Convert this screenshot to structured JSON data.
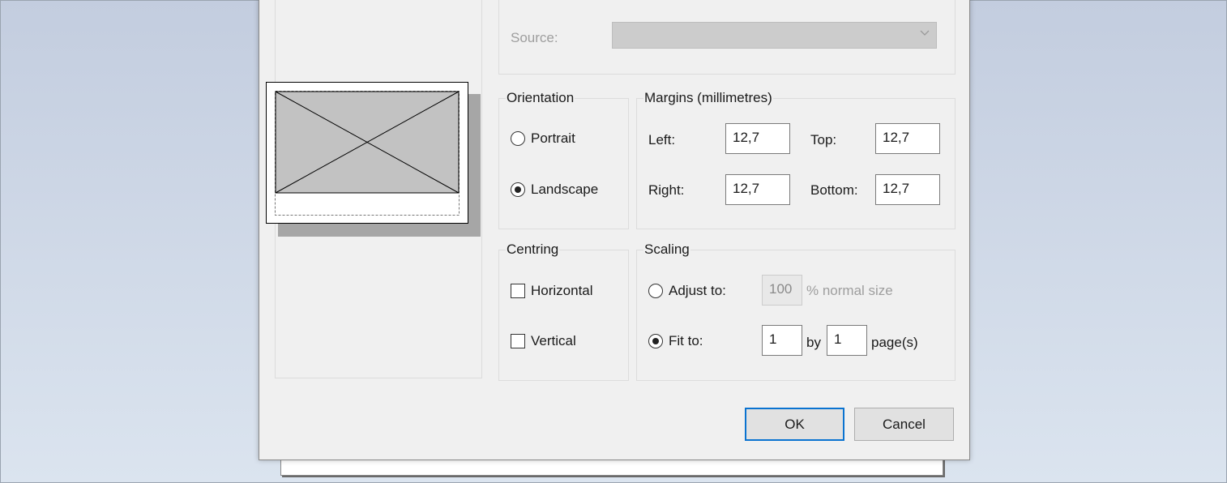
{
  "paper": {
    "source_label": "Source:",
    "source_value": ""
  },
  "orientation": {
    "title": "Orientation",
    "portrait_label": "Portrait",
    "landscape_label": "Landscape",
    "selected": "Landscape"
  },
  "margins": {
    "title": "Margins (millimetres)",
    "left_label": "Left:",
    "left_value": "12,7",
    "top_label": "Top:",
    "top_value": "12,7",
    "right_label": "Right:",
    "right_value": "12,7",
    "bottom_label": "Bottom:",
    "bottom_value": "12,7"
  },
  "centring": {
    "title": "Centring",
    "horizontal_label": "Horizontal",
    "vertical_label": "Vertical",
    "horizontal_checked": false,
    "vertical_checked": false
  },
  "scaling": {
    "title": "Scaling",
    "adjust_label": "Adjust to:",
    "adjust_value": "100",
    "adjust_suffix": "% normal size",
    "fit_label": "Fit to:",
    "fit_pages_wide": "1",
    "by_label": "by",
    "fit_pages_tall": "1",
    "pages_suffix": "page(s)",
    "selected": "Fit to"
  },
  "buttons": {
    "ok_label": "OK",
    "cancel_label": "Cancel"
  },
  "icons": [
    "chevron-down-icon",
    "page-preview-icon"
  ]
}
